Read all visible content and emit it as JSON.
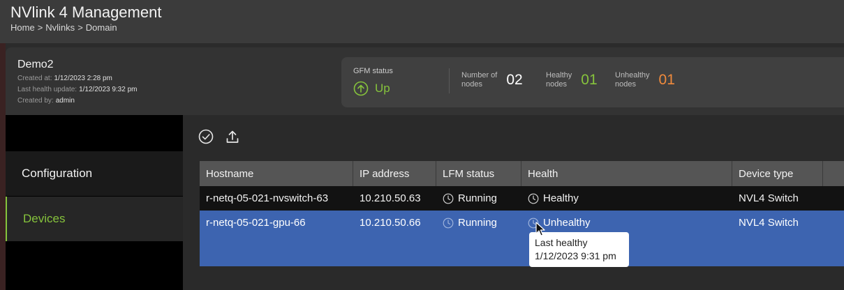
{
  "header": {
    "title": "NVlink 4 Management",
    "breadcrumb": [
      "Home",
      "Nvlinks",
      "Domain"
    ],
    "breadcrumb_sep": ">"
  },
  "domain": {
    "name": "Demo2",
    "created_at_label": "Created at:",
    "created_at": "1/12/2023 2:28 pm",
    "last_health_label": "Last health update:",
    "last_health": "1/12/2023 9:32 pm",
    "created_by_label": "Created by:",
    "created_by": "admin"
  },
  "status": {
    "gfm_label": "GFM status",
    "gfm_value": "Up",
    "nodes_label_1": "Number of",
    "nodes_label_2": "nodes",
    "nodes_value": "02",
    "healthy_label_1": "Healthy",
    "healthy_label_2": "nodes",
    "healthy_value": "01",
    "unhealthy_label_1": "Unhealthy",
    "unhealthy_label_2": "nodes",
    "unhealthy_value": "01"
  },
  "sidebar": {
    "items": [
      {
        "label": "Configuration"
      },
      {
        "label": "Devices"
      }
    ]
  },
  "toolbar": {
    "icons": [
      "check-circle-icon",
      "upload-icon"
    ]
  },
  "table": {
    "headers": [
      "Hostname",
      "IP address",
      "LFM status",
      "Health",
      "Device type"
    ],
    "rows": [
      {
        "hostname": "r-netq-05-021-nvswitch-63",
        "ip": "10.210.50.63",
        "lfm": "Running",
        "health": "Healthy",
        "type": "NVL4 Switch"
      },
      {
        "hostname": "r-netq-05-021-gpu-66",
        "ip": "10.210.50.66",
        "lfm": "Running",
        "health": "Unhealthy",
        "type": "NVL4 Switch"
      }
    ]
  },
  "tooltip": {
    "line1": "Last healthy",
    "line2": "1/12/2023 9:31 pm"
  },
  "colors": {
    "accent_green": "#86c33c",
    "orange": "#f08a3c",
    "selected_row": "#3d64b0"
  }
}
